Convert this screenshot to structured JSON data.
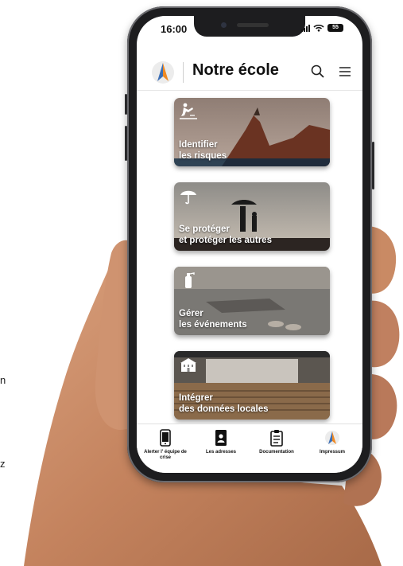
{
  "page_fragments": {
    "frag1": "n",
    "frag2": "z"
  },
  "status_bar": {
    "time": "16:00",
    "battery": "55"
  },
  "header": {
    "title": "Notre école",
    "search_icon": "search-icon",
    "menu_icon": "menu-icon"
  },
  "cards": [
    {
      "line1": "Identifier",
      "line2": "les risques",
      "icon": "slip-hazard-icon"
    },
    {
      "line1": "Se protéger",
      "line2": "et protéger les autres",
      "icon": "umbrella-icon"
    },
    {
      "line1": "Gérer",
      "line2": "les événements",
      "icon": "fire-extinguisher-icon"
    },
    {
      "line1": "Intégrer",
      "line2": "des données locales",
      "icon": "school-building-icon"
    }
  ],
  "tabs": [
    {
      "label": "Alerter l' équipe de crise",
      "icon": "alert-phone-icon"
    },
    {
      "label": "Les adresses",
      "icon": "address-book-icon"
    },
    {
      "label": "Documentation",
      "icon": "clipboard-icon"
    },
    {
      "label": "Impressum",
      "icon": "app-logo-icon"
    }
  ],
  "colors": {
    "logo_orange": "#f08a24",
    "logo_blue": "#3d6fb6",
    "phone_frame": "#1d1d1f"
  }
}
